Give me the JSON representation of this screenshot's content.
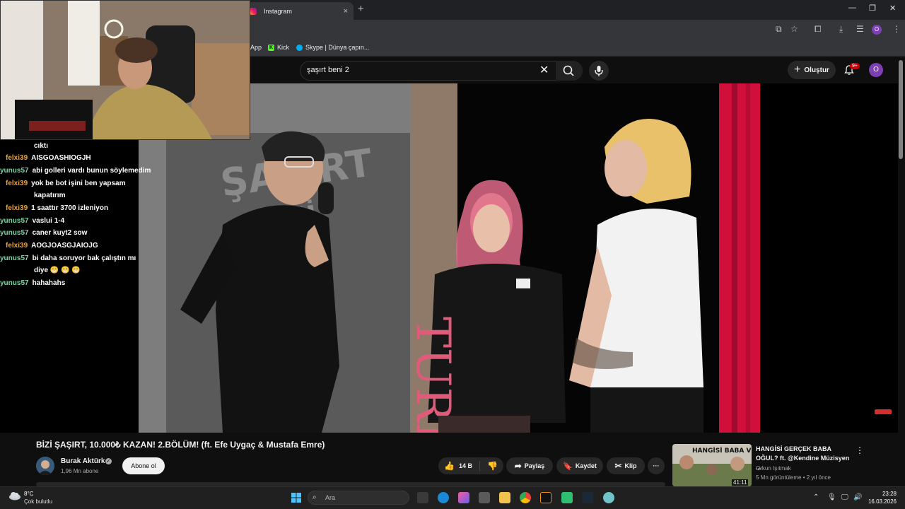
{
  "browser": {
    "tab_title": "Instagram",
    "tab_close": "×",
    "new_tab": "+",
    "bookmarks": [
      "App",
      "Kick",
      "Skype | Dünya çapın..."
    ],
    "profile_initial": "O"
  },
  "youtube": {
    "search_query": "şaşırt beni 2",
    "create_label": "Oluştur",
    "notif_count": "9+",
    "avatar_initial": "O"
  },
  "chat": {
    "messages": [
      {
        "user": "",
        "text": "cıktı"
      },
      {
        "user": "felxi39",
        "text": "AISGOASHIOGJH"
      },
      {
        "user": "yunus57",
        "text": "abi golleri vardı bunun söylemedim"
      },
      {
        "user": "felxi39",
        "text": "yok be bot işini ben yapsam"
      },
      {
        "user": "",
        "text": "kapatırım"
      },
      {
        "user": "felxi39",
        "text": "1 saattır 3700 izleniyon"
      },
      {
        "user": "yunus57",
        "text": "vaslui 1-4"
      },
      {
        "user": "yunus57",
        "text": "caner kuyt2 sow"
      },
      {
        "user": "felxi39",
        "text": "AOGJOASGJAIOJG"
      },
      {
        "user": "yunus57",
        "text": "bi daha soruyor bak çalıştın mı"
      },
      {
        "user": "",
        "text": "diye 😁 😁 😁"
      },
      {
        "user": "yunus57",
        "text": "hahahahs"
      }
    ]
  },
  "video": {
    "title": "BİZİ ŞAŞIRT, 10.000₺ KAZAN! 2.BÖLÜM! (ft. Efe Uygaç & Mustafa Emre)",
    "channel": "Burak Aktürk",
    "subscribers": "1,96 Mn abone",
    "subscribe_label": "Abone ol",
    "likes": "14 B",
    "share_label": "Paylaş",
    "save_label": "Kaydet",
    "clip_label": "Klip",
    "more_label": "···"
  },
  "recommendation": {
    "title": "HANGİSİ GERÇEK BABA OĞUL? ft. @Kendine Müzisyen ...",
    "channel": "Orkun Işıtmak",
    "meta": "5 Mn görüntüleme • 2 yıl önce",
    "duration": "41:11",
    "thumb_text": "HANGİSİ BABA VE OĞUL?"
  },
  "taskbar": {
    "temp": "8°C",
    "weather": "Çok bulutlu",
    "search_placeholder": "Ara",
    "time": "23:28",
    "date": "16.03.2026"
  },
  "colors": {
    "yt_bg": "#0f0f0f",
    "chat_user_1": "#e8a33c",
    "chat_user_2": "#7ad3a6",
    "curtain_red": "#d0103a"
  }
}
